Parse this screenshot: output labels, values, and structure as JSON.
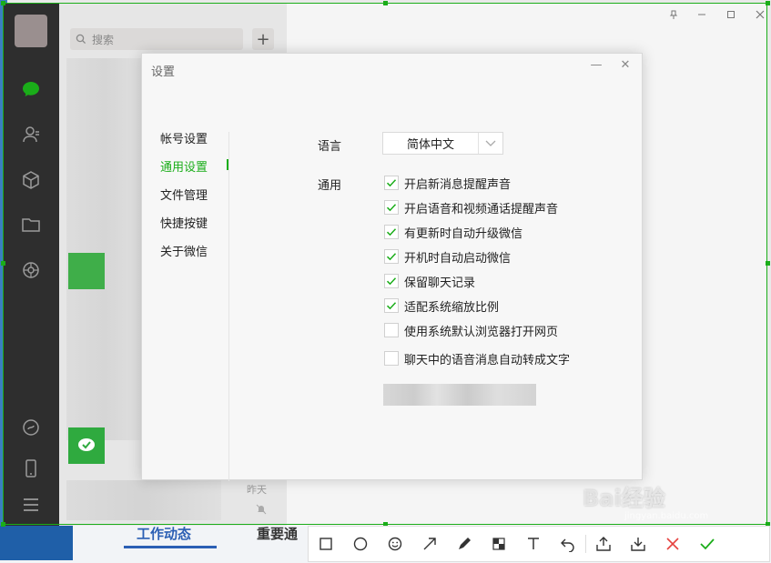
{
  "listpane": {
    "search_placeholder": "搜索",
    "add_symbol": "+",
    "last_item_time": "昨天"
  },
  "background_page": {
    "link1": "工作动态",
    "link2": "重要通"
  },
  "dialog": {
    "title": "设置",
    "minimize": "—",
    "close": "✕",
    "menu": [
      {
        "label": "帐号设置",
        "active": false
      },
      {
        "label": "通用设置",
        "active": true
      },
      {
        "label": "文件管理",
        "active": false
      },
      {
        "label": "快捷按键",
        "active": false
      },
      {
        "label": "关于微信",
        "active": false
      }
    ],
    "language_label": "语言",
    "language_value": "简体中文",
    "general_label": "通用",
    "options": [
      {
        "label": "开启新消息提醒声音",
        "checked": true
      },
      {
        "label": "开启语音和视频通话提醒声音",
        "checked": true
      },
      {
        "label": "有更新时自动升级微信",
        "checked": true
      },
      {
        "label": "开机时自动启动微信",
        "checked": true
      },
      {
        "label": "保留聊天记录",
        "checked": true
      },
      {
        "label": "适配系统缩放比例",
        "checked": true
      },
      {
        "label": "使用系统默认浏览器打开网页",
        "checked": false
      },
      {
        "label": "聊天中的语音消息自动转成文字",
        "checked": false
      }
    ]
  },
  "colors": {
    "accent": "#1aad19",
    "sidebar": "#2e2e2e"
  },
  "watermark": {
    "text": "Bai经验",
    "sub": "jingyan.baidu.com"
  },
  "toolbar": {
    "icons": [
      "rectangle-icon",
      "circle-icon",
      "emoji-icon",
      "arrow-icon",
      "pen-icon",
      "mosaic-icon",
      "text-icon",
      "undo-icon",
      "pin-icon",
      "save-icon",
      "cancel-icon",
      "confirm-icon"
    ]
  }
}
